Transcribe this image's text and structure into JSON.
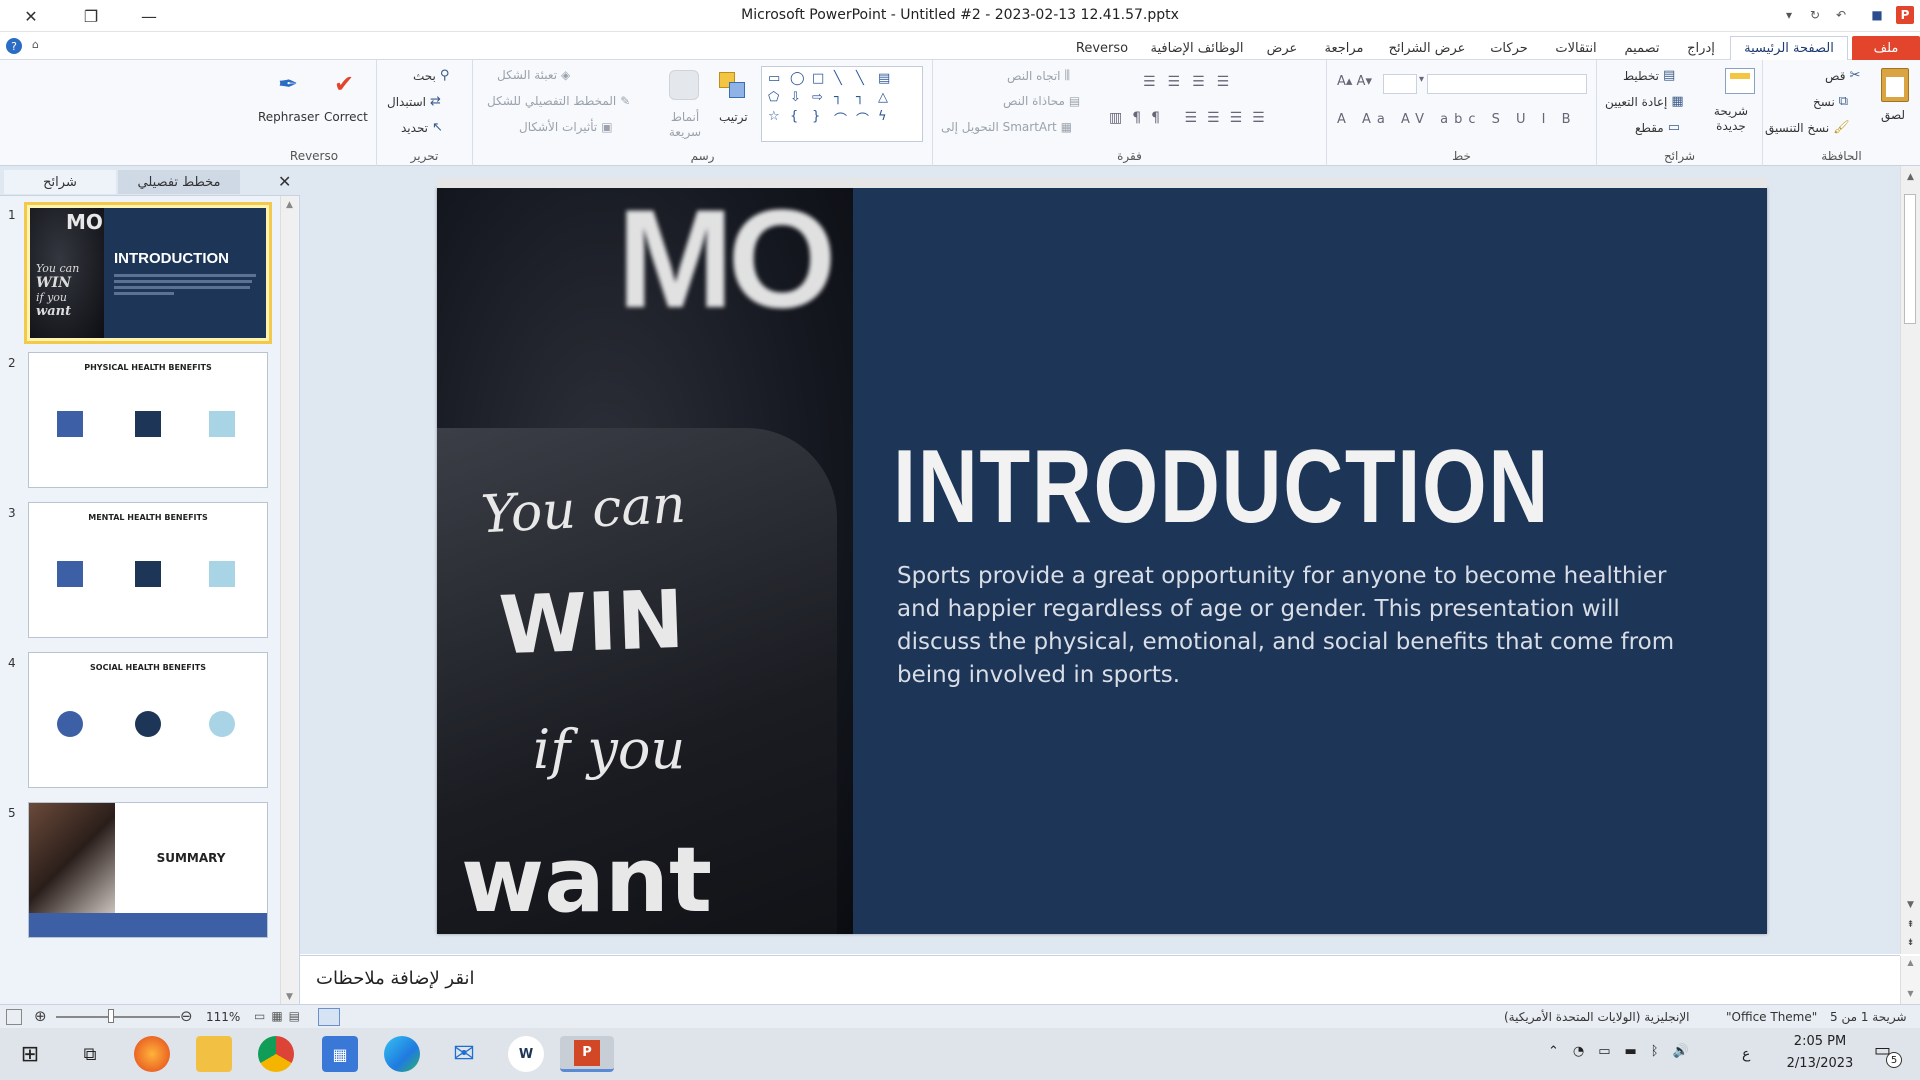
{
  "window": {
    "title": "Microsoft PowerPoint  -  Untitled #2 - 2023-02-13 12.41.57.pptx"
  },
  "ribbon_tabs": [
    {
      "label": "ملف"
    },
    {
      "label": "الصفحة الرئيسية"
    },
    {
      "label": "إدراج"
    },
    {
      "label": "تصميم"
    },
    {
      "label": "انتقالات"
    },
    {
      "label": "حركات"
    },
    {
      "label": "عرض الشرائح"
    },
    {
      "label": "مراجعة"
    },
    {
      "label": "عرض"
    },
    {
      "label": "الوظائف الإضافية"
    },
    {
      "label": "Reverso"
    }
  ],
  "ribbon": {
    "clipboard": {
      "label": "الحافظة",
      "paste": "لصق",
      "cut": "قص",
      "copy": "نسخ",
      "format_painter": "نسخ التنسيق"
    },
    "slides": {
      "label": "شرائح",
      "new_slide": "شريحة جديدة",
      "layout": "تخطيط",
      "reset": "إعادة التعيين",
      "section": "مقطع"
    },
    "font": {
      "label": "خط"
    },
    "paragraph": {
      "label": "فقرة",
      "text_direction": "اتجاه النص",
      "align_text": "محاذاة النص",
      "smartart": "التحويل إلى SmartArt"
    },
    "drawing": {
      "label": "رسم",
      "arrange": "ترتيب",
      "quick_styles": "أنماط سريعة",
      "shape_fill": "تعبئة الشكل",
      "shape_outline": "المخطط التفصيلي للشكل",
      "shape_effects": "تأثيرات الأشكال"
    },
    "editing": {
      "label": "تحرير",
      "find": "بحث",
      "replace": "استبدال",
      "select": "تحديد"
    },
    "reverso": {
      "label": "Reverso",
      "rephraser": "Rephraser",
      "correct": "Correct"
    }
  },
  "panel": {
    "tab_outline": "مخطط تفصيلي",
    "tab_slides": "شرائح"
  },
  "thumbnails": [
    {
      "num": "1",
      "title": "INTRODUCTION"
    },
    {
      "num": "2",
      "title": "PHYSICAL HEALTH BENEFITS"
    },
    {
      "num": "3",
      "title": "MENTAL HEALTH BENEFITS"
    },
    {
      "num": "4",
      "title": "SOCIAL HEALTH BENEFITS"
    },
    {
      "num": "5",
      "title": "SUMMARY"
    }
  ],
  "slide": {
    "title": "INTRODUCTION",
    "body": "Sports provide a great opportunity for anyone to become healthier and happier regardless of age or gender. This presentation will discuss the physical, emotional, and social benefits that come from being involved in sports.",
    "photo_text": {
      "line1": "You can",
      "line2": "WIN",
      "line3": "if you",
      "line4": "want",
      "top": "MO"
    }
  },
  "notes": {
    "placeholder": "انقر لإضافة ملاحظات"
  },
  "status": {
    "slide_info": "شريحة 1 من 5",
    "theme": "\"Office Theme\"",
    "language": "الإنجليزية (الولايات المتحدة الأمريكية)",
    "zoom": "111%"
  },
  "taskbar": {
    "time": "2:05 PM",
    "date": "2/13/2023",
    "lang": "ع",
    "notif_count": "5"
  },
  "colors": {
    "slide_bg": "#1d3557",
    "accent_file_tab": "#e3452c"
  }
}
